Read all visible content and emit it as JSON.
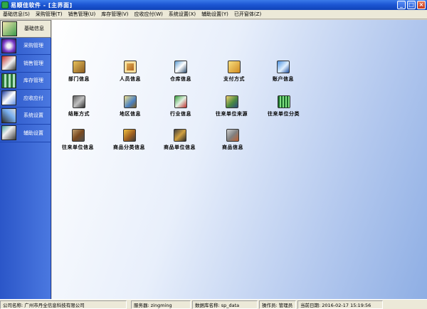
{
  "window": {
    "title": "易顺佳软件 - [主界面]"
  },
  "menu": [
    "基础信息(S)",
    "采购管理(T)",
    "销售管理(U)",
    "库存管理(V)",
    "应收应付(W)",
    "系统设置(X)",
    "辅助设置(Y)",
    "已开窗体(Z)"
  ],
  "sidebar": [
    {
      "label": "基础信息",
      "icon": "basic-info-icon",
      "active": true
    },
    {
      "label": "采购管理",
      "icon": "purchase-icon",
      "active": false
    },
    {
      "label": "销售管理",
      "icon": "sales-icon",
      "active": false
    },
    {
      "label": "库存管理",
      "icon": "inventory-icon",
      "active": false
    },
    {
      "label": "应收应付",
      "icon": "receivable-icon",
      "active": false
    },
    {
      "label": "系统设置",
      "icon": "system-settings-icon",
      "active": false
    },
    {
      "label": "辅助设置",
      "icon": "aux-settings-icon",
      "active": false
    }
  ],
  "tiles": [
    {
      "label": "部门信息",
      "icon": "department-icon"
    },
    {
      "label": "人员信息",
      "icon": "personnel-icon"
    },
    {
      "label": "仓库信息",
      "icon": "warehouse-icon"
    },
    {
      "label": "支付方式",
      "icon": "payment-method-icon"
    },
    {
      "label": "账户信息",
      "icon": "account-icon"
    },
    {
      "label": "结账方式",
      "icon": "settlement-icon"
    },
    {
      "label": "地区信息",
      "icon": "region-icon"
    },
    {
      "label": "行业信息",
      "icon": "industry-icon"
    },
    {
      "label": "往来单位来源",
      "icon": "partner-source-icon"
    },
    {
      "label": "往来单位分类",
      "icon": "partner-category-icon"
    },
    {
      "label": "往来单位信息",
      "icon": "partner-info-icon"
    },
    {
      "label": "商品分类信息",
      "icon": "product-category-icon"
    },
    {
      "label": "商品单位信息",
      "icon": "product-unit-icon"
    },
    {
      "label": "商品信息",
      "icon": "product-info-icon"
    }
  ],
  "status": {
    "company": "公司名称: 广州市丹全信息科技有限公司",
    "server": "服务器: zingming",
    "database": "数据库名称: sp_data",
    "operator": "操作员: 管理员",
    "date": "当前日期: 2016-02-17 15:19:56"
  }
}
